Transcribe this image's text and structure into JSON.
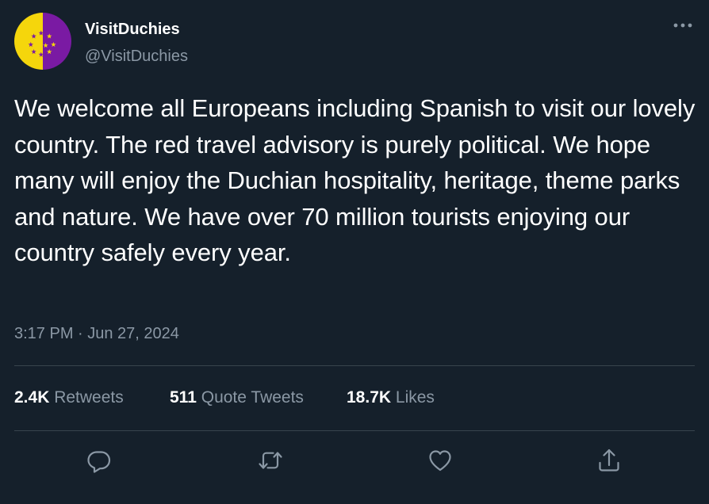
{
  "author": {
    "display_name": "VisitDuchies",
    "handle": "@VisitDuchies",
    "avatar": {
      "left_color": "#f5d60c",
      "right_color": "#7a1aa3",
      "star_color": "#f5d60c",
      "icon": "star-circle-flag"
    }
  },
  "tweet": {
    "text": "We welcome all Europeans including Spanish to visit our lovely country. The red travel advisory is purely political. We hope many will enjoy the Duchian hospitality, heritage, theme parks and nature. We have over 70 million tourists enjoying our country safely every year.",
    "timestamp": "3:17 PM · Jun 27, 2024"
  },
  "stats": {
    "retweets": {
      "count": "2.4K",
      "label": "Retweets"
    },
    "quote_tweets": {
      "count": "511",
      "label": "Quote Tweets"
    },
    "likes": {
      "count": "18.7K",
      "label": "Likes"
    }
  },
  "actions": {
    "reply_icon": "reply-icon",
    "retweet_icon": "retweet-icon",
    "like_icon": "heart-icon",
    "share_icon": "share-icon",
    "more_icon": "more-icon"
  },
  "theme": {
    "background": "#15202b",
    "text": "#ffffff",
    "secondary_text": "#8b98a5",
    "divider": "#38444d"
  }
}
